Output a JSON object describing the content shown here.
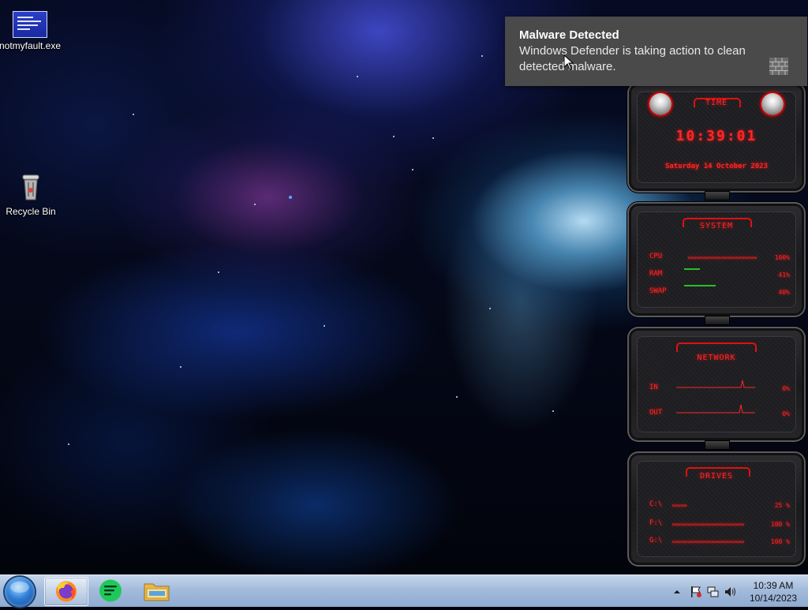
{
  "desktop": {
    "icons": [
      {
        "label": "notmyfault.exe",
        "icon": "blue-screen-icon"
      },
      {
        "label": "Recycle Bin",
        "icon": "recycle-bin-icon"
      }
    ]
  },
  "notification": {
    "title": "Malware Detected",
    "body": "Windows Defender is taking action to clean detected malware.",
    "icon": "brick-wall-icon"
  },
  "skin": {
    "accent": "#ff2626",
    "time_panel": {
      "title": "TIME",
      "clock": "10:39:01",
      "date": "Saturday 14 October 2023"
    },
    "system_panel": {
      "title": "SYSTEM",
      "rows": [
        {
          "label": "CPU",
          "value": "100%",
          "fill": 1.0
        },
        {
          "label": "RAM",
          "value": "41%",
          "fill": 0.41
        },
        {
          "label": "SWAP",
          "value": "40%",
          "fill": 0.4
        }
      ]
    },
    "network_panel": {
      "title": "NETWORK",
      "rows": [
        {
          "label": "IN",
          "value": "0%"
        },
        {
          "label": "OUT",
          "value": "0%"
        }
      ]
    },
    "drives_panel": {
      "title": "DRIVES",
      "rows": [
        {
          "label": "C:\\",
          "value": "25 %",
          "fill": 0.25
        },
        {
          "label": "F:\\",
          "value": "100 %",
          "fill": 1.0
        },
        {
          "label": "G:\\",
          "value": "100 %",
          "fill": 1.0
        }
      ]
    }
  },
  "taskbar": {
    "start": "start-orb",
    "apps": [
      {
        "name": "Firefox",
        "icon": "firefox-icon",
        "active": true
      },
      {
        "name": "Notes",
        "icon": "green-notes-icon",
        "active": false
      },
      {
        "name": "File Explorer",
        "icon": "folder-icon",
        "active": false
      }
    ],
    "tray_icons": [
      "show-hidden-icons-chevron",
      "action-center-flag-icon",
      "network-icon",
      "volume-icon"
    ],
    "clock": {
      "time": "10:39 AM",
      "date": "10/14/2023"
    }
  }
}
